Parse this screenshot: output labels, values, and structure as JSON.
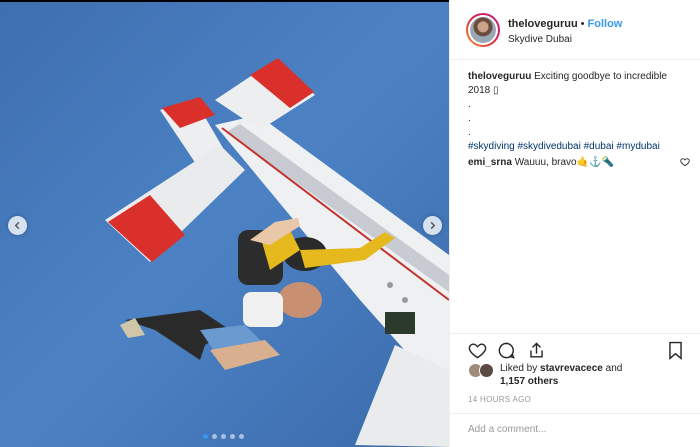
{
  "post": {
    "username": "theloveguruu",
    "separator": "•",
    "follow_label": "Follow",
    "location": "Skydive Dubai"
  },
  "caption": {
    "username": "theloveguruu",
    "text": "Exciting goodbye to incredible 2018 ▯",
    "dots": [
      ".",
      ".",
      "."
    ],
    "hashtags": "#skydiving #skydivedubai #dubai #mydubai"
  },
  "comments": [
    {
      "username": "emi_srna",
      "text": "Wauuu, bravo🤙⚓🔦"
    }
  ],
  "likes": {
    "prefix": "Liked by ",
    "user": "stavrevacece",
    "middle": " and",
    "others": "1,157 others"
  },
  "timestamp": "14 HOURS AGO",
  "add_comment": {
    "placeholder": "Add a comment..."
  },
  "carousel": {
    "total": 5,
    "active_index": 0
  },
  "icons": {
    "like": "heart-icon",
    "comment": "comment-icon",
    "share": "share-icon",
    "save": "bookmark-icon",
    "prev": "chevron-left-icon",
    "next": "chevron-right-icon"
  },
  "colors": {
    "accent": "#3897f0",
    "hashtag": "#003569",
    "muted": "#999999"
  }
}
